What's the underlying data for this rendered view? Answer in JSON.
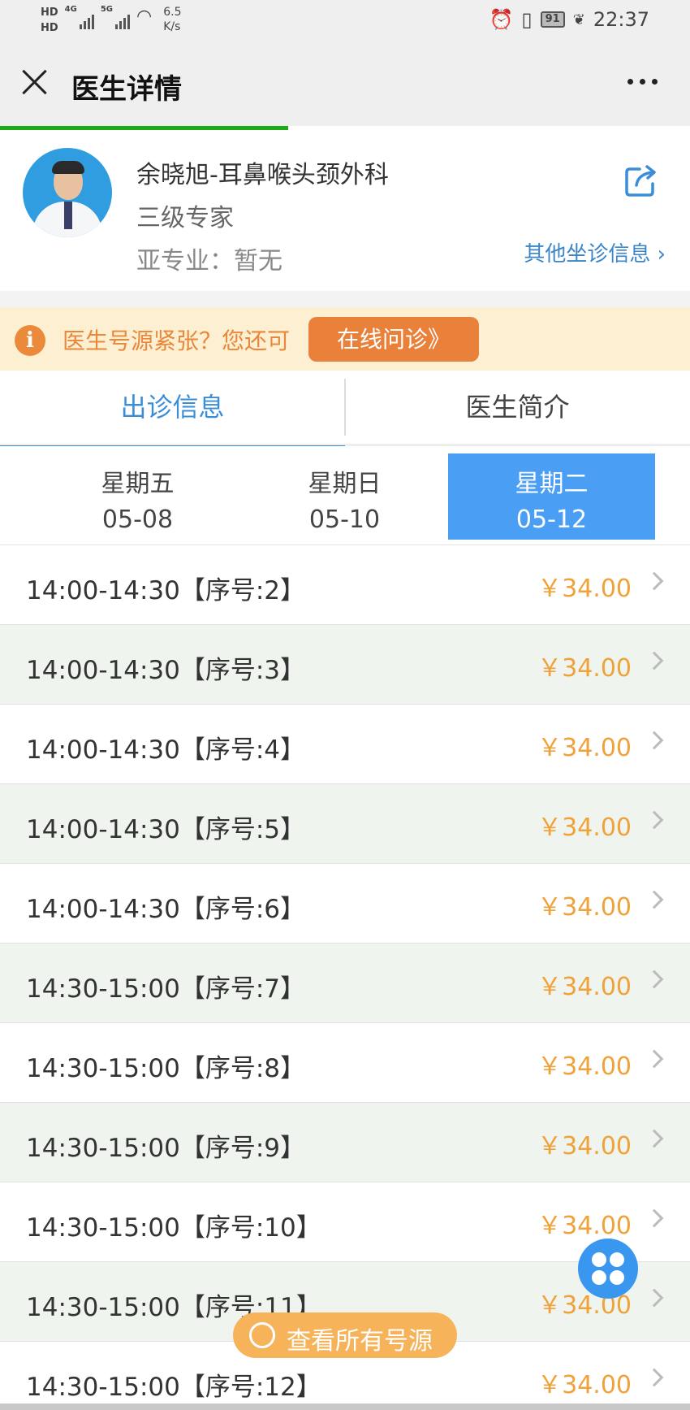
{
  "status_bar": {
    "hd1": "HD",
    "hd2": "HD",
    "net1": "4G",
    "net2": "5G",
    "speed_value": "6.5",
    "speed_unit": "K/s",
    "battery": "91",
    "time": "22:37"
  },
  "nav": {
    "title": "医生详情"
  },
  "doctor": {
    "name": "余晓旭-耳鼻喉头颈外科",
    "level": "三级专家",
    "subspecialty": "亚专业：暂无",
    "other_info": "其他坐诊信息"
  },
  "notice": {
    "text": "医生号源紧张？您还可",
    "button": "在线问诊》"
  },
  "tabs": [
    {
      "label": "出诊信息"
    },
    {
      "label": "医生简介"
    }
  ],
  "dates": [
    {
      "weekday": "星期五",
      "date": "05-08"
    },
    {
      "weekday": "星期日",
      "date": "05-10"
    },
    {
      "weekday": "星期二",
      "date": "05-12"
    }
  ],
  "slots": [
    {
      "time": "14:00-14:30【序号:2】",
      "price": "￥34.00"
    },
    {
      "time": "14:00-14:30【序号:3】",
      "price": "￥34.00"
    },
    {
      "time": "14:00-14:30【序号:4】",
      "price": "￥34.00"
    },
    {
      "time": "14:00-14:30【序号:5】",
      "price": "￥34.00"
    },
    {
      "time": "14:00-14:30【序号:6】",
      "price": "￥34.00"
    },
    {
      "time": "14:30-15:00【序号:7】",
      "price": "￥34.00"
    },
    {
      "time": "14:30-15:00【序号:8】",
      "price": "￥34.00"
    },
    {
      "time": "14:30-15:00【序号:9】",
      "price": "￥34.00"
    },
    {
      "time": "14:30-15:00【序号:10】",
      "price": "￥34.00"
    },
    {
      "time": "14:30-15:00【序号:11】",
      "price": "￥34.00"
    },
    {
      "time": "14:30-15:00【序号:12】",
      "price": "￥34.00"
    }
  ],
  "float": {
    "view_all": "查看所有号源"
  },
  "colors": {
    "accent_blue": "#3a8ed8",
    "active_date_bg": "#4a9ff5",
    "price_orange": "#f0a23a",
    "notice_bg": "#fdf0d2",
    "consult_btn": "#e9813b",
    "progress_green": "#1aad19"
  }
}
